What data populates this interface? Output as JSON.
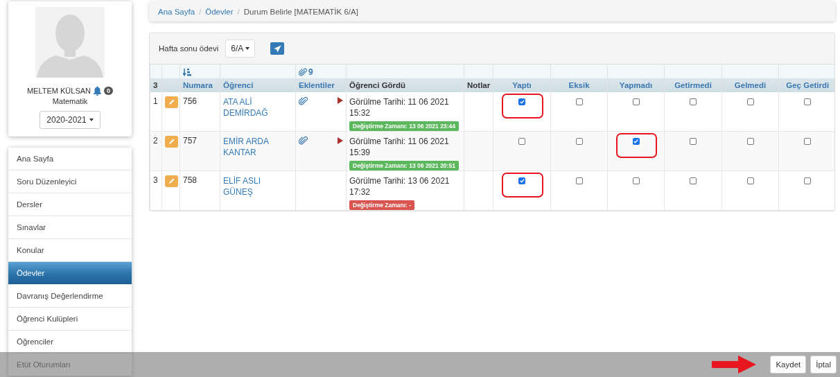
{
  "profile": {
    "name": "MELTEM KÜLSAN",
    "notification_count": "0",
    "subject": "Matematik",
    "year": "2020-2021"
  },
  "menu": [
    {
      "label": "Ana Sayfa",
      "selected": false
    },
    {
      "label": "Soru Düzenleyici",
      "selected": false
    },
    {
      "label": "Dersler",
      "selected": false
    },
    {
      "label": "Sınavlar",
      "selected": false
    },
    {
      "label": "Konular",
      "selected": false
    },
    {
      "label": "Ödevler",
      "selected": true
    },
    {
      "label": "Davranış Değerlendirme",
      "selected": false
    },
    {
      "label": "Öğrenci Kulüpleri",
      "selected": false
    },
    {
      "label": "Öğrenciler",
      "selected": false
    },
    {
      "label": "Etüt Oturumları",
      "selected": false
    }
  ],
  "breadcrumb": [
    {
      "label": "Ana Sayfa",
      "kind": "link"
    },
    {
      "separator": "/",
      "label": "Ödevler",
      "kind": "link"
    },
    {
      "separator": "/",
      "label": "Durum Belirle [MATEMATİK 6/A]",
      "kind": "current"
    }
  ],
  "toolbar": {
    "title": "Hafta sonu ödevi",
    "class_select": "6/A"
  },
  "table": {
    "count": "3",
    "attachment_count": "9",
    "columns": [
      "Numara",
      "Öğrenci",
      "Eklentiler",
      "Öğrenci Gördü",
      "Notlar",
      "Yaptı",
      "Eksik",
      "Yapmadı",
      "Getirmedi",
      "Gelmedi",
      "Geç Getirdi"
    ],
    "rows": [
      {
        "index": "1",
        "number": "756",
        "name": "ATA ALİ DEMİRDAĞ",
        "attachment": true,
        "seen": "Görülme Tarihi: 11 06 2021 15:32",
        "change": {
          "text": "Değiştirme Zamanı: 13 06 2021 23:44",
          "color": "#5cb85c"
        },
        "checks": [
          {
            "checked": true,
            "highlighted": true
          },
          {
            "checked": false,
            "highlighted": false
          },
          {
            "checked": false,
            "highlighted": false
          },
          {
            "checked": false,
            "highlighted": false
          },
          {
            "checked": false,
            "highlighted": false
          },
          {
            "checked": false,
            "highlighted": false
          }
        ]
      },
      {
        "index": "2",
        "number": "757",
        "name": "EMİR ARDA KANTAR",
        "attachment": true,
        "seen": "Görülme Tarihi: 11 06 2021 15:39",
        "change": {
          "text": "Değiştirme Zamanı: 13 06 2021 20:51",
          "color": "#5cb85c"
        },
        "checks": [
          {
            "checked": false,
            "highlighted": false
          },
          {
            "checked": false,
            "highlighted": false
          },
          {
            "checked": true,
            "highlighted": true
          },
          {
            "checked": false,
            "highlighted": false
          },
          {
            "checked": false,
            "highlighted": false
          },
          {
            "checked": false,
            "highlighted": false
          }
        ]
      },
      {
        "index": "3",
        "number": "758",
        "name": "ELİF ASLI GÜNEŞ",
        "attachment": false,
        "seen": "Görülme Tarihi: 13 06 2021 17:32",
        "change": {
          "text": "Değiştirme Zamanı: -",
          "color": "#d9534f"
        },
        "checks": [
          {
            "checked": true,
            "highlighted": true
          },
          {
            "checked": false,
            "highlighted": false
          },
          {
            "checked": false,
            "highlighted": false
          },
          {
            "checked": false,
            "highlighted": false
          },
          {
            "checked": false,
            "highlighted": false
          },
          {
            "checked": false,
            "highlighted": false
          }
        ]
      }
    ]
  },
  "footer": {
    "buttons": [
      "Kaydet",
      "İptal"
    ]
  }
}
